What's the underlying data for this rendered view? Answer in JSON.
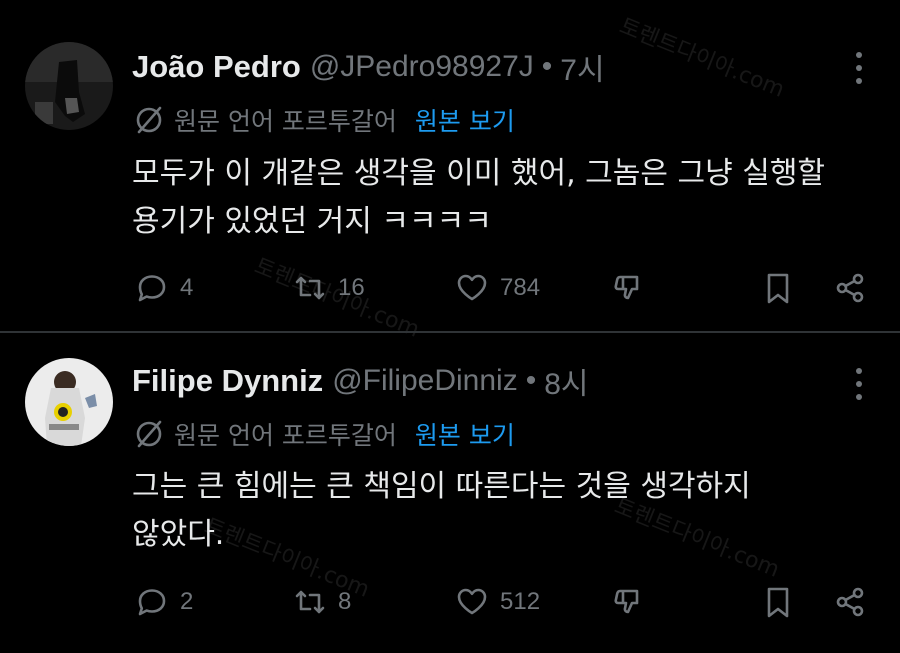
{
  "watermark": "토렌트다이아.com",
  "colors": {
    "background": "#000000",
    "primary_text": "#e7e9ea",
    "secondary_text": "#71767b",
    "link": "#1d9bf0",
    "divider": "#2f3336"
  },
  "posts": [
    {
      "display_name": "João Pedro",
      "handle": "@JPedro98927J",
      "separator": "•",
      "time": "7시",
      "translate_note": "원문 언어 포르투갈어",
      "translate_link": "원본 보기",
      "text": "모두가 이 개같은 생각을 이미 했어, 그놈은 그냥 실행할\n용기가 있었던 거지 ㅋㅋㅋㅋ",
      "reply_count": "4",
      "retweet_count": "16",
      "like_count": "784",
      "icons": [
        "reply-icon",
        "retweet-icon",
        "heart-icon",
        "dislike-icon",
        "bookmark-icon",
        "share-icon"
      ]
    },
    {
      "display_name": "Filipe Dynniz",
      "handle": "@FilipeDinniz",
      "separator": "•",
      "time": "8시",
      "translate_note": "원문 언어 포르투갈어",
      "translate_link": "원본 보기",
      "text": "그는 큰 힘에는 큰 책임이 따른다는 것을 생각하지\n않았다.",
      "reply_count": "2",
      "retweet_count": "8",
      "like_count": "512",
      "icons": [
        "reply-icon",
        "retweet-icon",
        "heart-icon",
        "dislike-icon",
        "bookmark-icon",
        "share-icon"
      ]
    }
  ]
}
